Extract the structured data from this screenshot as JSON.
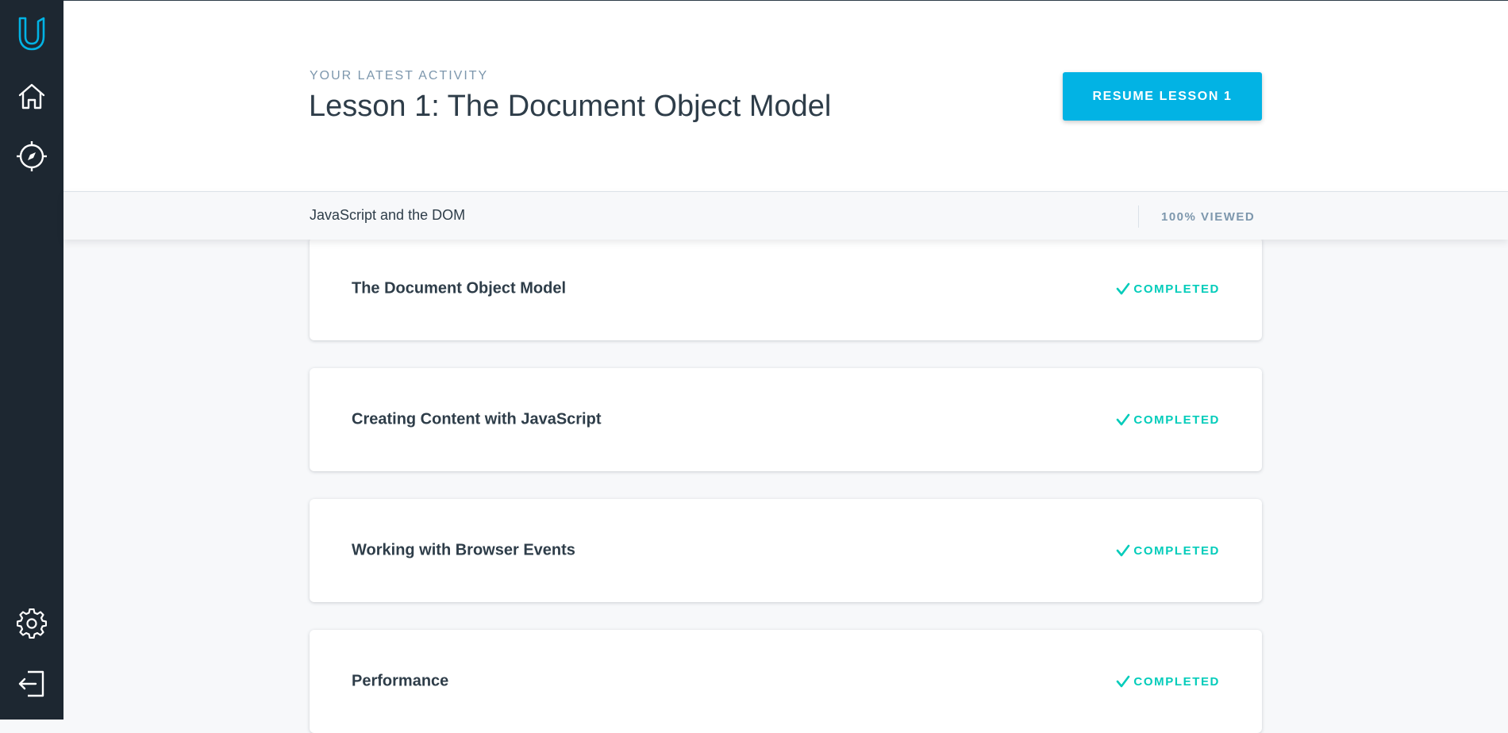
{
  "sidebar": {
    "icons": [
      "udacity-logo-icon",
      "home-icon",
      "compass-icon",
      "gear-icon",
      "logout-icon"
    ]
  },
  "header": {
    "eyebrow": "YOUR LATEST ACTIVITY",
    "title": "Lesson 1: The Document Object Model",
    "resume_label": "RESUME LESSON 1"
  },
  "subbar": {
    "course_name": "JavaScript and the DOM",
    "viewed": "100% VIEWED"
  },
  "lessons": [
    {
      "title": "The Document Object Model",
      "status": "COMPLETED"
    },
    {
      "title": "Creating Content with JavaScript",
      "status": "COMPLETED"
    },
    {
      "title": "Working with Browser Events",
      "status": "COMPLETED"
    },
    {
      "title": "Performance",
      "status": "COMPLETED"
    }
  ],
  "colors": {
    "sidebar": "#1d2731",
    "accent": "#02b3e4",
    "completed": "#02ccba",
    "text": "#2e3d49",
    "muted": "#7d97ad"
  }
}
